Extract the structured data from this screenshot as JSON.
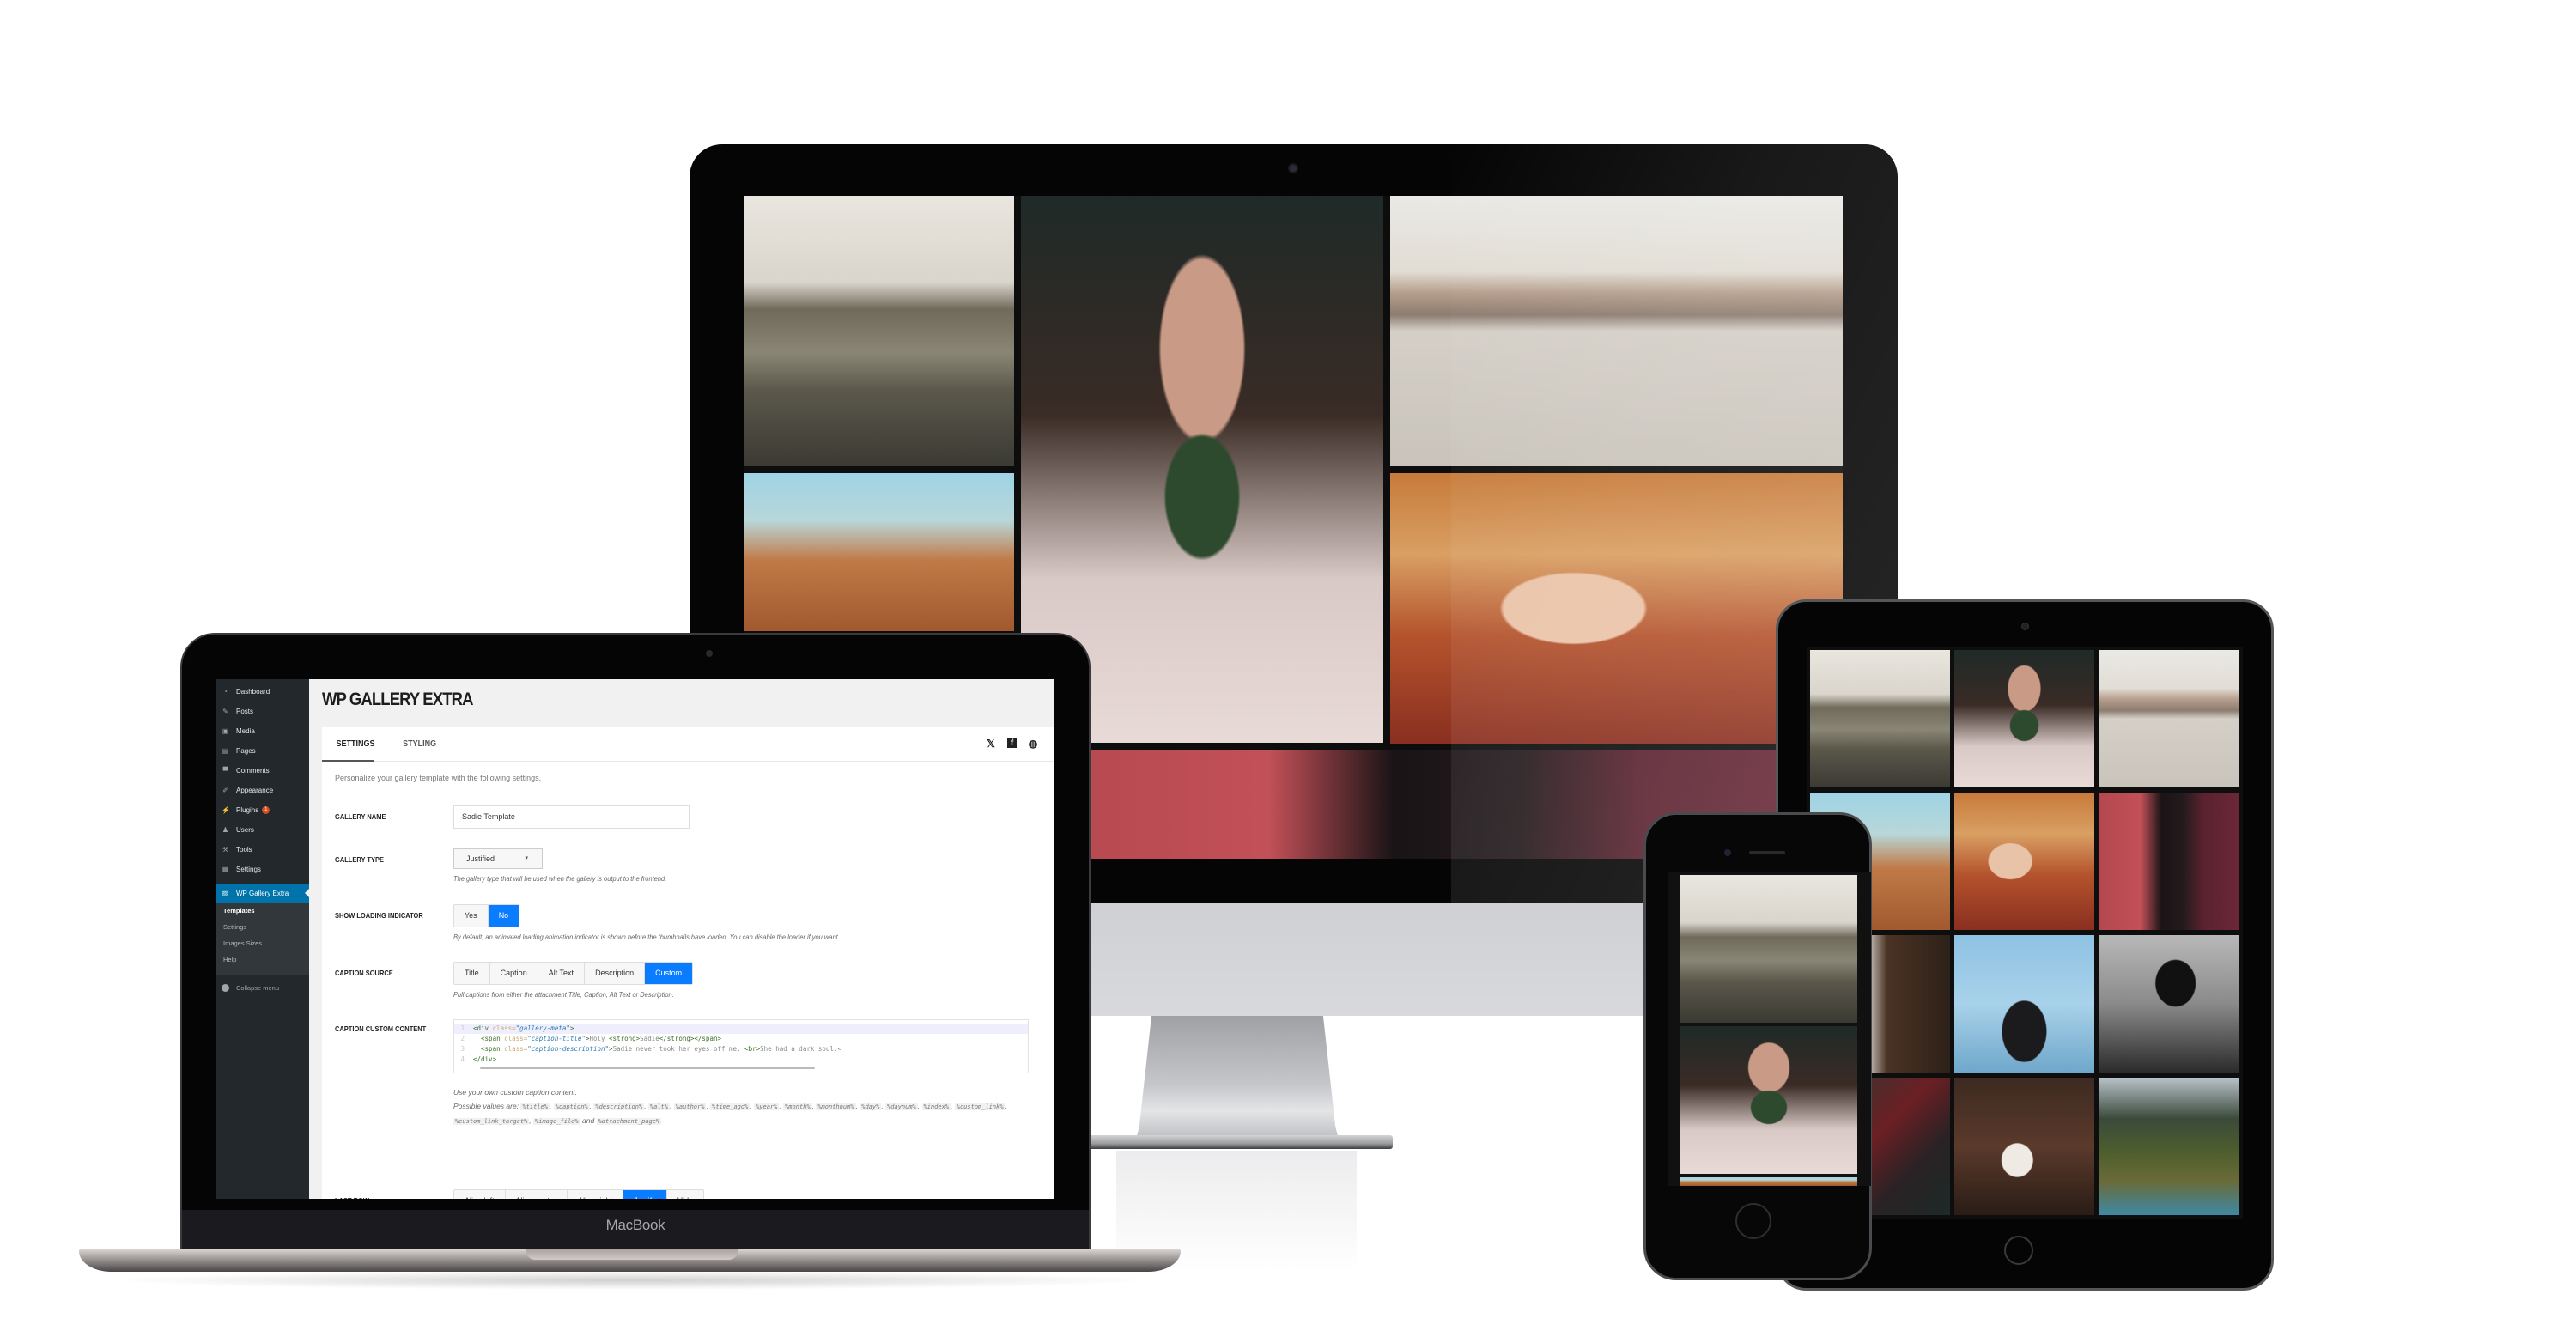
{
  "imac": {
    "gallery": [
      {
        "name": "cliff-woman-flag",
        "style": "ph-cliff"
      },
      {
        "name": "girl-flower-crown-leaf",
        "style": "ph-leaf"
      },
      {
        "name": "woman-desert-hat",
        "style": "ph-desert"
      },
      {
        "name": "woman-windblown-hair",
        "style": "ph-hair"
      },
      {
        "name": "woman-autumn-leaves",
        "style": "ph-autumn"
      },
      {
        "name": "woman-red-sweater-foliage",
        "style": "ph-red"
      }
    ]
  },
  "macbook": {
    "brand": "MacBook",
    "sidebar": {
      "items": [
        {
          "label": "Dashboard",
          "icon": "dashboard-icon",
          "glyph": "◔"
        },
        {
          "label": "Posts",
          "icon": "pin-icon",
          "glyph": "✎"
        },
        {
          "label": "Media",
          "icon": "media-icon",
          "glyph": "▣"
        },
        {
          "label": "Pages",
          "icon": "pages-icon",
          "glyph": "▤"
        },
        {
          "label": "Comments",
          "icon": "comment-icon",
          "glyph": "▀"
        },
        {
          "label": "Appearance",
          "icon": "brush-icon",
          "glyph": "✐"
        },
        {
          "label": "Plugins",
          "icon": "plug-icon",
          "glyph": "⚡",
          "badge": "1"
        },
        {
          "label": "Users",
          "icon": "user-icon",
          "glyph": "♟"
        },
        {
          "label": "Tools",
          "icon": "wrench-icon",
          "glyph": "⚒"
        },
        {
          "label": "Settings",
          "icon": "settings-icon",
          "glyph": "▦"
        }
      ],
      "active": {
        "label": "WP Gallery Extra",
        "icon": "gallery-icon",
        "glyph": "▨"
      },
      "submenu": [
        "Templates",
        "Settings",
        "Images Sizes",
        "Help"
      ],
      "submenu_current": "Templates",
      "collapse": "Collapse menu"
    },
    "page": {
      "title": "WP GALLERY EXTRA",
      "tabs": [
        "SETTINGS",
        "STYLING"
      ],
      "active_tab": "SETTINGS",
      "social": [
        {
          "name": "twitter-icon",
          "glyph": "🐦"
        },
        {
          "name": "facebook-icon",
          "glyph": "f"
        },
        {
          "name": "globe-icon",
          "glyph": "◍"
        }
      ],
      "intro": "Personalize your gallery template with the following settings.",
      "fields": {
        "gallery_name": {
          "label": "GALLERY NAME",
          "value": "Sadie Template"
        },
        "gallery_type": {
          "label": "GALLERY TYPE",
          "value": "Justified",
          "help": "The gallery type that will be used when the gallery is output to the frontend."
        },
        "loading": {
          "label": "SHOW LOADING INDICATOR",
          "options": [
            "Yes",
            "No"
          ],
          "selected": "No",
          "help": "By default, an animated loading animation indicator is shown before the thumbnails have loaded. You can disable the loader if you want."
        },
        "caption_source": {
          "label": "CAPTION SOURCE",
          "options": [
            "Title",
            "Caption",
            "Alt Text",
            "Description",
            "Custom"
          ],
          "selected": "Custom",
          "help": "Pull captions from either the attachment Title, Caption, Alt Text or Description."
        },
        "caption_custom": {
          "label": "CAPTION CUSTOM CONTENT",
          "code": [
            {
              "n": "1",
              "parts": [
                [
                  "tag",
                  "<div "
                ],
                [
                  "attr",
                  "class="
                ],
                [
                  "str",
                  "\"gallery-meta\""
                ],
                [
                  "tag",
                  ">"
                ]
              ]
            },
            {
              "n": "2",
              "parts": [
                [
                  "txt",
                  "  "
                ],
                [
                  "tag",
                  "<span "
                ],
                [
                  "attr",
                  "class="
                ],
                [
                  "str",
                  "\"caption-title\""
                ],
                [
                  "tag",
                  ">"
                ],
                [
                  "txt",
                  "Holy "
                ],
                [
                  "tag",
                  "<strong>"
                ],
                [
                  "txt",
                  "Sadie"
                ],
                [
                  "tag",
                  "</strong></span>"
                ]
              ]
            },
            {
              "n": "3",
              "parts": [
                [
                  "txt",
                  "  "
                ],
                [
                  "tag",
                  "<span "
                ],
                [
                  "attr",
                  "class="
                ],
                [
                  "str",
                  "\"caption-description\""
                ],
                [
                  "tag",
                  ">"
                ],
                [
                  "txt",
                  "Sadie never took her eyes off me. "
                ],
                [
                  "tag",
                  "<br>"
                ],
                [
                  "txt",
                  "She had a dark soul.<"
                ]
              ]
            },
            {
              "n": "4",
              "parts": [
                [
                  "tag",
                  "</div>"
                ]
              ]
            }
          ],
          "help_line1": "Use your own custom caption content.",
          "help_prefix": "Possible values are:",
          "variables": [
            "%title%",
            "%caption%",
            "%description%",
            "%alt%",
            "%author%",
            "%time_ago%",
            "%year%",
            "%month%",
            "%monthnum%",
            "%day%",
            "%daynum%",
            "%index%",
            "%custom_link%",
            "%custom_link_target%",
            "%image_file%",
            "%attachment_page%"
          ],
          "help_and": "and"
        },
        "last_row": {
          "label": "LAST ROW",
          "options": [
            "Align left",
            "Align center",
            "Align right",
            "Justify",
            "Hide"
          ],
          "selected": "Justify"
        }
      }
    }
  },
  "ipad": {
    "gallery": [
      {
        "name": "cliff-woman-flag",
        "style": "ph-cliff"
      },
      {
        "name": "girl-leaf",
        "style": "ph-leaf"
      },
      {
        "name": "woman-desert-hat",
        "style": "ph-desert"
      },
      {
        "name": "woman-windblown-hair",
        "style": "ph-hair"
      },
      {
        "name": "woman-autumn-leaves",
        "style": "ph-autumn"
      },
      {
        "name": "woman-red-foliage",
        "style": "ph-red"
      },
      {
        "name": "man-cap-scarf",
        "style": "ph-cap"
      },
      {
        "name": "woman-blue-smoke",
        "style": "ph-smoke"
      },
      {
        "name": "man-black-hat",
        "style": "ph-hat"
      },
      {
        "name": "person-plaid-shirt",
        "style": "ph-plaid"
      },
      {
        "name": "woman-forest-looking-up",
        "style": "ph-forest"
      },
      {
        "name": "feet-over-mountain-valley",
        "style": "ph-mountain"
      }
    ]
  },
  "iphone": {
    "gallery": [
      {
        "name": "cliff-woman-flag",
        "style": "ph-cliff"
      },
      {
        "name": "girl-leaf",
        "style": "ph-leaf"
      },
      {
        "name": "partial-next-image",
        "style": "ph-hair"
      }
    ]
  },
  "colors": {
    "accent_blue": "#0a7cff",
    "wp_sidebar": "#23282d",
    "wp_active": "#0073aa",
    "badge": "#d54e21"
  }
}
